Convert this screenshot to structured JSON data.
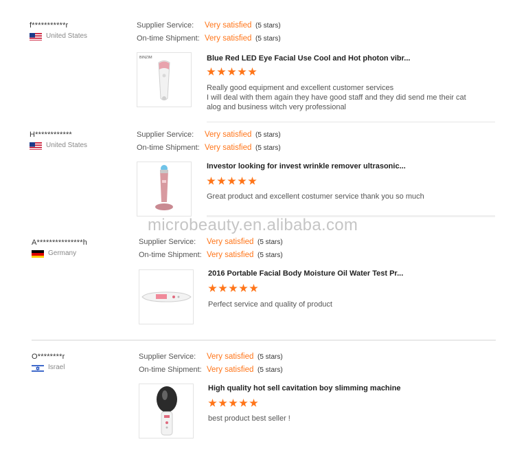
{
  "watermark": "microbeauty.en.alibaba.com",
  "labels": {
    "supplier_service": "Supplier Service:",
    "on_time_shipment": "On-time Shipment:"
  },
  "reviews": [
    {
      "username": "f***********r",
      "country": "United States",
      "flag": "us-flag-icon",
      "supplier_service": "Very satisfied",
      "supplier_stars": "(5 stars)",
      "shipment": "Very satisfied",
      "shipment_stars": "(5 stars)",
      "product_title": "Blue Red LED Eye Facial Use Cool and Hot photon vibr...",
      "product_brand": "BINZIM",
      "rating": 5,
      "text_lines": [
        "Really good equipment and excellent customer services",
        "I will deal with them again they have good staff and they did send me their cat",
        "alog and business witch very professional"
      ]
    },
    {
      "username": "H************",
      "country": "United States",
      "flag": "us-flag-icon",
      "supplier_service": "Very satisfied",
      "supplier_stars": "(5 stars)",
      "shipment": "Very satisfied",
      "shipment_stars": "(5 stars)",
      "product_title": "Investor looking for invest wrinkle remover ultrasonic...",
      "rating": 5,
      "text_lines": [
        "Great product and excellent costumer service thank you so much"
      ]
    },
    {
      "username": "A***************h",
      "country": "Germany",
      "flag": "germany-flag-icon",
      "supplier_service": "Very satisfied",
      "supplier_stars": "(5 stars)",
      "shipment": "Very satisfied",
      "shipment_stars": "(5 stars)",
      "product_title": "2016 Portable Facial Body Moisture Oil Water Test Pr...",
      "rating": 5,
      "text_lines": [
        "Perfect service and quality of product"
      ]
    },
    {
      "username": "O********r",
      "country": "Israel",
      "flag": "israel-flag-icon",
      "supplier_service": "Very satisfied",
      "supplier_stars": "(5 stars)",
      "shipment": "Very satisfied",
      "shipment_stars": "(5 stars)",
      "product_title": "High quality hot sell cavitation boy slimming machine",
      "rating": 5,
      "text_lines": [
        "best product best seller !"
      ]
    }
  ]
}
